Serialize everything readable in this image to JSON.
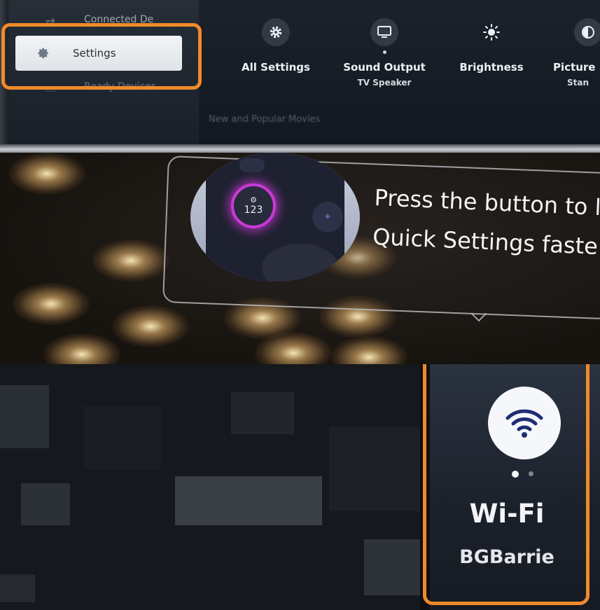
{
  "tv_menu": {
    "left_menu": {
      "items": [
        {
          "label": "Connected De",
          "icon": "link-icon"
        },
        {
          "label": "Settings",
          "icon": "gear-icon",
          "selected": true
        },
        {
          "label": "Ready Devices",
          "icon": "device-icon"
        }
      ]
    },
    "quick_settings": [
      {
        "label": "All Settings",
        "sub": "",
        "icon": "gear-icon"
      },
      {
        "label": "Sound Output",
        "sub": "TV Speaker",
        "icon": "tv-icon"
      },
      {
        "label": "Brightness",
        "sub": "",
        "icon": "sun-icon"
      },
      {
        "label": "Picture",
        "sub": "Stan",
        "icon": "picture-mode-icon"
      }
    ],
    "row_label": "New and Popular Movies"
  },
  "tip": {
    "line1": "Press the button to l",
    "line2": "Quick Settings faste",
    "remote_button_label": "123"
  },
  "wifi": {
    "title": "Wi-Fi",
    "network": "BGBarrie",
    "icon": "wifi-icon",
    "page_count": 2,
    "active_page": 0
  },
  "colors": {
    "highlight": "#f08a2c",
    "remote_glow": "#c93ad6"
  }
}
